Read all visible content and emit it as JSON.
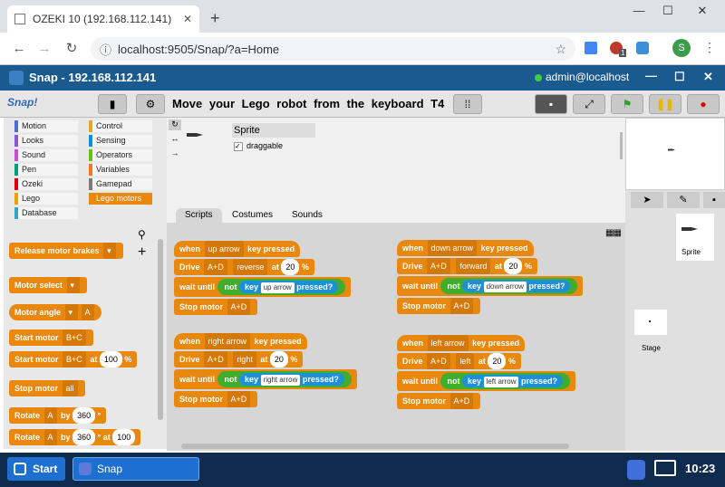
{
  "browser": {
    "tab_title": "OZEKI 10 (192.168.112.141)",
    "url": "localhost:9505/Snap/?a=Home",
    "profile_initial": "S",
    "ext_badge": "1"
  },
  "snap": {
    "title": "Snap - 192.168.112.141",
    "user": "admin@localhost",
    "logo": "Snap!",
    "project_name": "Move your Lego robot from the keyboard T4"
  },
  "categories": [
    {
      "label": "Motion",
      "color": "#4a6cd4"
    },
    {
      "label": "Control",
      "color": "#e6a822"
    },
    {
      "label": "Looks",
      "color": "#8a55d7"
    },
    {
      "label": "Sensing",
      "color": "#0494dc"
    },
    {
      "label": "Sound",
      "color": "#cf4ad9"
    },
    {
      "label": "Operators",
      "color": "#62c213"
    },
    {
      "label": "Pen",
      "color": "#00a178"
    },
    {
      "label": "Variables",
      "color": "#f3761d"
    },
    {
      "label": "Ozeki",
      "color": "#e00000"
    },
    {
      "label": "Gamepad",
      "color": "#7a7a7a"
    },
    {
      "label": "Lego",
      "color": "#f0a000"
    },
    {
      "label": "Lego motors",
      "color": "#e8880f"
    },
    {
      "label": "Database",
      "color": "#2fa8c8"
    }
  ],
  "palette": {
    "release": "Release motor brakes",
    "motor_select": "Motor select",
    "motor_angle": "Motor angle",
    "motor_angle_val": "A",
    "start_motor": "Start motor",
    "bc": "B+C",
    "at": "at",
    "speed": "100",
    "pct": "%",
    "stop_motor": "Stop motor",
    "all": "all",
    "rotate": "Rotate",
    "by": "by",
    "deg_val": "360",
    "deg": "°",
    "a": "A"
  },
  "sprite": {
    "name": "Sprite",
    "draggable": "draggable"
  },
  "tabs": [
    "Scripts",
    "Costumes",
    "Sounds"
  ],
  "scripts": {
    "when": "when",
    "key_pressed": "key pressed",
    "drive": "Drive",
    "ad": "A+D",
    "at": "at",
    "pct": "%",
    "wait_until": "wait until",
    "not": "not",
    "key": "key",
    "pressed_q": "pressed?",
    "stop_motor": "Stop motor",
    "s1": {
      "key": "up arrow",
      "dir": "reverse",
      "speed": "20"
    },
    "s2": {
      "key": "down arrow",
      "dir": "forward",
      "speed": "20"
    },
    "s3": {
      "key": "right arrow",
      "dir": "right",
      "speed": "20"
    },
    "s4": {
      "key": "left arrow",
      "dir": "left",
      "speed": "20"
    }
  },
  "corral": {
    "sprite_label": "Sprite",
    "stage_label": "Stage"
  },
  "taskbar": {
    "start": "Start",
    "snap": "Snap",
    "clock": "10:23"
  }
}
